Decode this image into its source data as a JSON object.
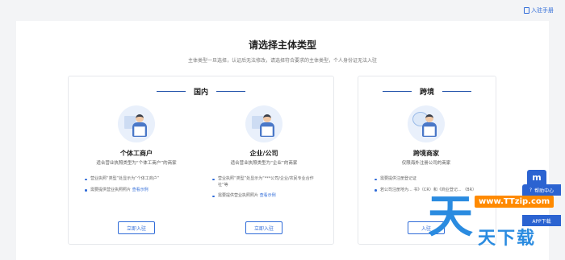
{
  "header": {
    "manual_label": "入驻手册"
  },
  "main": {
    "title": "请选择主体类型",
    "subtitle": "主体类型一旦选择，认证后无法修改，请选择符合要求的主体类型，个人身份证无法入驻"
  },
  "domestic": {
    "heading": "国内",
    "cards": [
      {
        "name": "个体工商户",
        "desc": "适合营业执照类型为“个体工商户”的商家",
        "reqs": [
          "营业执照“类型”处显示为“个体工商户”",
          "需要提供营业执照照片"
        ],
        "example_link": "查看示例",
        "button": "立即入驻"
      },
      {
        "name": "企业/公司",
        "desc": "适合营业执照类型为“企业”的商家",
        "reqs": [
          "营业执照“类型”处显示为“***公司/企业/农民专业合作社”等",
          "需要提供营业执照照片"
        ],
        "example_link": "查看示例",
        "button": "立即入驻"
      }
    ]
  },
  "crossborder": {
    "heading": "跨境",
    "card": {
      "name": "跨境商家",
      "desc": "仅限海外注册公司的商家",
      "reqs": [
        "需要提供注册登记证",
        "若公司注册地为... 书》（CR）和《商业登记... （BR）"
      ],
      "button": "入驻"
    }
  },
  "floating": {
    "help": "帮助中心",
    "app": "APP下载"
  },
  "watermark": {
    "char": "天",
    "site": "www.TTzip.com",
    "tail": "天下载"
  },
  "colors": {
    "accent": "#2f6bd8",
    "float_bg": "#2b63d1",
    "watermark_blue": "#2a8be0",
    "watermark_orange": "#ff8a00"
  }
}
